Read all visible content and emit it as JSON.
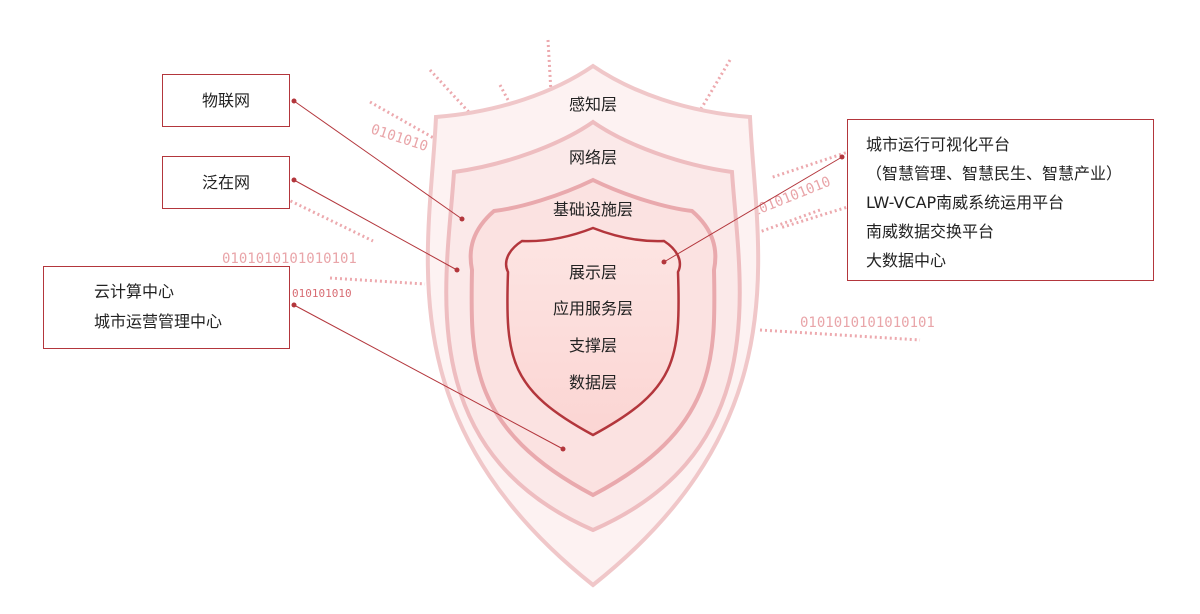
{
  "shield": {
    "layers": [
      {
        "label": "感知层"
      },
      {
        "label": "网络层"
      },
      {
        "label": "基础设施层"
      }
    ],
    "core_layers": [
      "展示层",
      "应用服务层",
      "支撑层",
      "数据层"
    ]
  },
  "callouts": {
    "iot": "物联网",
    "pervasive": "泛在网",
    "cloud": [
      "云计算中心",
      "城市运营管理中心"
    ],
    "platforms": [
      "城市运行可视化平台",
      "（智慧管理、智慧民生、智慧产业）",
      "LW-VCAP南威系统运用平台",
      "南威数据交换平台",
      "大数据中心"
    ]
  },
  "binary_strings": [
    "0101010101010101",
    "010101010",
    "0101010101010101",
    "0101010101010",
    "0101010",
    "0101010101010101"
  ],
  "colors": {
    "accent": "#b3363c",
    "outer_fill": "#fdf1f1",
    "core_fill": "#fbd8d6"
  }
}
